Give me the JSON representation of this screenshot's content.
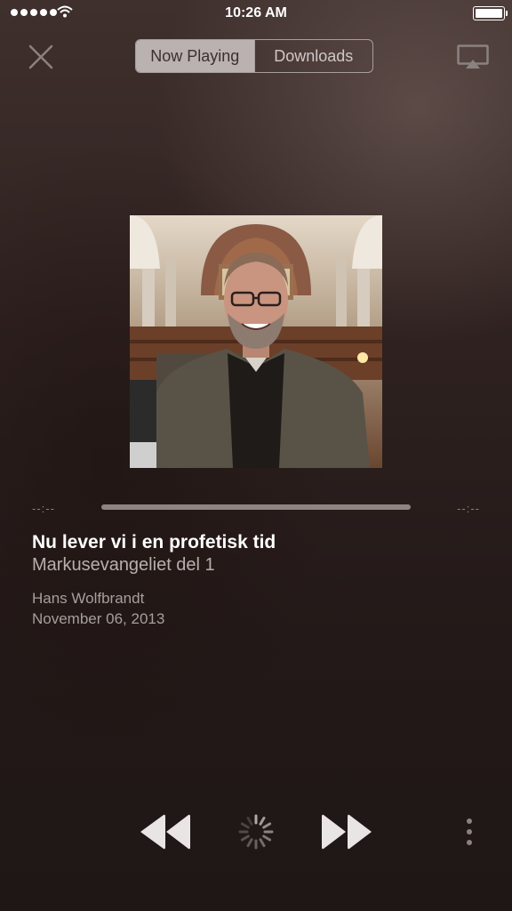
{
  "status_bar": {
    "time": "10:26 AM"
  },
  "header": {
    "tabs": [
      {
        "label": "Now Playing",
        "active": true
      },
      {
        "label": "Downloads",
        "active": false
      }
    ]
  },
  "player": {
    "elapsed": "--:--",
    "remaining": "--:--",
    "title": "Nu lever vi i en profetisk tid",
    "subtitle": "Markusevangeliet del 1",
    "speaker": "Hans Wolfbrandt",
    "date": "November 06, 2013"
  },
  "icons": {
    "close": "close-icon",
    "airplay": "airplay-icon",
    "rewind": "rewind-icon",
    "loading": "loading-spinner-icon",
    "forward": "fast-forward-icon",
    "more": "more-vertical-icon"
  },
  "colors": {
    "background": "#2a1f1d",
    "segment_active": "#b9b2b0",
    "text_secondary": "#a79f9c"
  }
}
